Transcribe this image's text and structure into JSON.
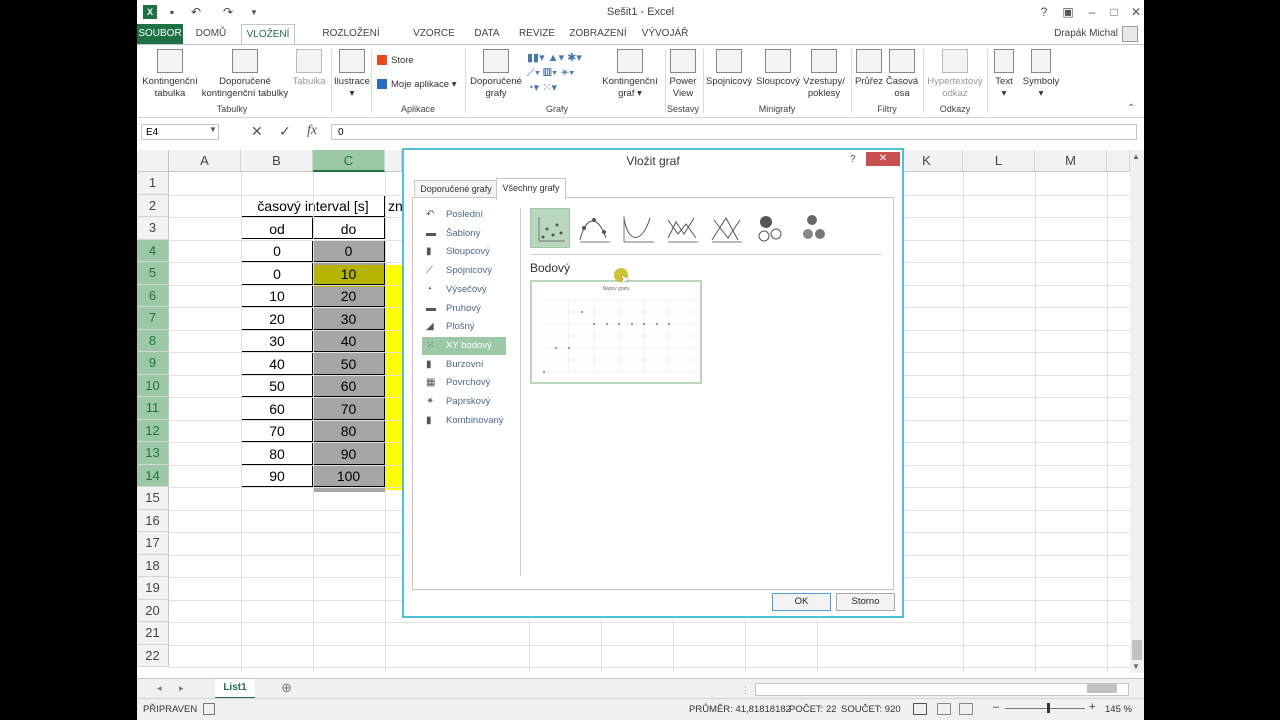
{
  "window": {
    "title": "Sešit1 - Excel",
    "user": "Drapák Michal"
  },
  "tabs": [
    "SOUBOR",
    "DOMŮ",
    "VLOŽENÍ",
    "ROZLOŽENÍ STRÁNKY",
    "VZORCE",
    "DATA",
    "REVIZE",
    "ZOBRAZENÍ",
    "VÝVOJÁŘ"
  ],
  "ribbon": {
    "pivot_table": "Kontingenční tabulka",
    "recommended_pivot": "Doporučené kontingenční tabulky",
    "table": "Tabulka",
    "group_tables": "Tabulky",
    "illustrations": "Ilustrace",
    "store": "Store",
    "my_apps": "Moje aplikace",
    "group_apps": "Aplikace",
    "recommended_charts": "Doporučené grafy",
    "pivot_chart": "Kontingenční graf",
    "group_charts": "Grafy",
    "power_view": "Power View",
    "group_reports": "Sestavy",
    "spark_line": "Spojnicový",
    "spark_column": "Sloupcový",
    "spark_winloss": "Vzestupy/ poklesy",
    "group_sparklines": "Minigrafy",
    "slicer": "Průřez",
    "timeline": "Časová osa",
    "group_filters": "Filtry",
    "hyperlink": "Hypertextový odkaz",
    "group_links": "Odkazy",
    "text": "Text",
    "symbols": "Symboly"
  },
  "formula_bar": {
    "name_box": "E4",
    "formula": "0",
    "fx": "fx"
  },
  "columns": [
    "A",
    "B",
    "C",
    "K",
    "L",
    "M"
  ],
  "rows": [
    "1",
    "2",
    "3",
    "4",
    "5",
    "6",
    "7",
    "8",
    "9",
    "10",
    "11",
    "12",
    "13",
    "14",
    "15",
    "16",
    "17",
    "18",
    "19",
    "20",
    "21",
    "22"
  ],
  "table": {
    "header": "časový interval [s]",
    "header_partial": "zn",
    "sub_from": "od",
    "sub_to": "do",
    "from": [
      "0",
      "0",
      "10",
      "20",
      "30",
      "40",
      "50",
      "60",
      "70",
      "80",
      "90"
    ],
    "to": [
      "0",
      "10",
      "20",
      "30",
      "40",
      "50",
      "60",
      "70",
      "80",
      "90",
      "100"
    ]
  },
  "dialog": {
    "title": "Vložit graf",
    "help": "?",
    "tab_recommended": "Doporučené grafy",
    "tab_all": "Všechny grafy",
    "nav": [
      "Poslední",
      "Šablony",
      "Sloupcový",
      "Spojnicový",
      "Výsečový",
      "Pruhový",
      "Plošný",
      "XY bodový",
      "Burzovní",
      "Povrchový",
      "Paprskový",
      "Kombinovaný"
    ],
    "selected_nav": "XY bodový",
    "subtype_title": "Bodový",
    "preview_title": "Název grafu",
    "ok": "OK",
    "cancel": "Storno"
  },
  "sheet": {
    "tab": "List1"
  },
  "status": {
    "ready": "PŘIPRAVEN",
    "average": "PRŮMĚR: 41,81818182",
    "count": "POČET: 22",
    "sum": "SOUČET: 920",
    "zoom": "145 %"
  },
  "colors": {
    "excel_green": "#217346",
    "yellow": "#ffff00",
    "olive": "#b4b400",
    "gray_sel": "#a6a6a6",
    "dialog_border": "#4fc1d6"
  }
}
